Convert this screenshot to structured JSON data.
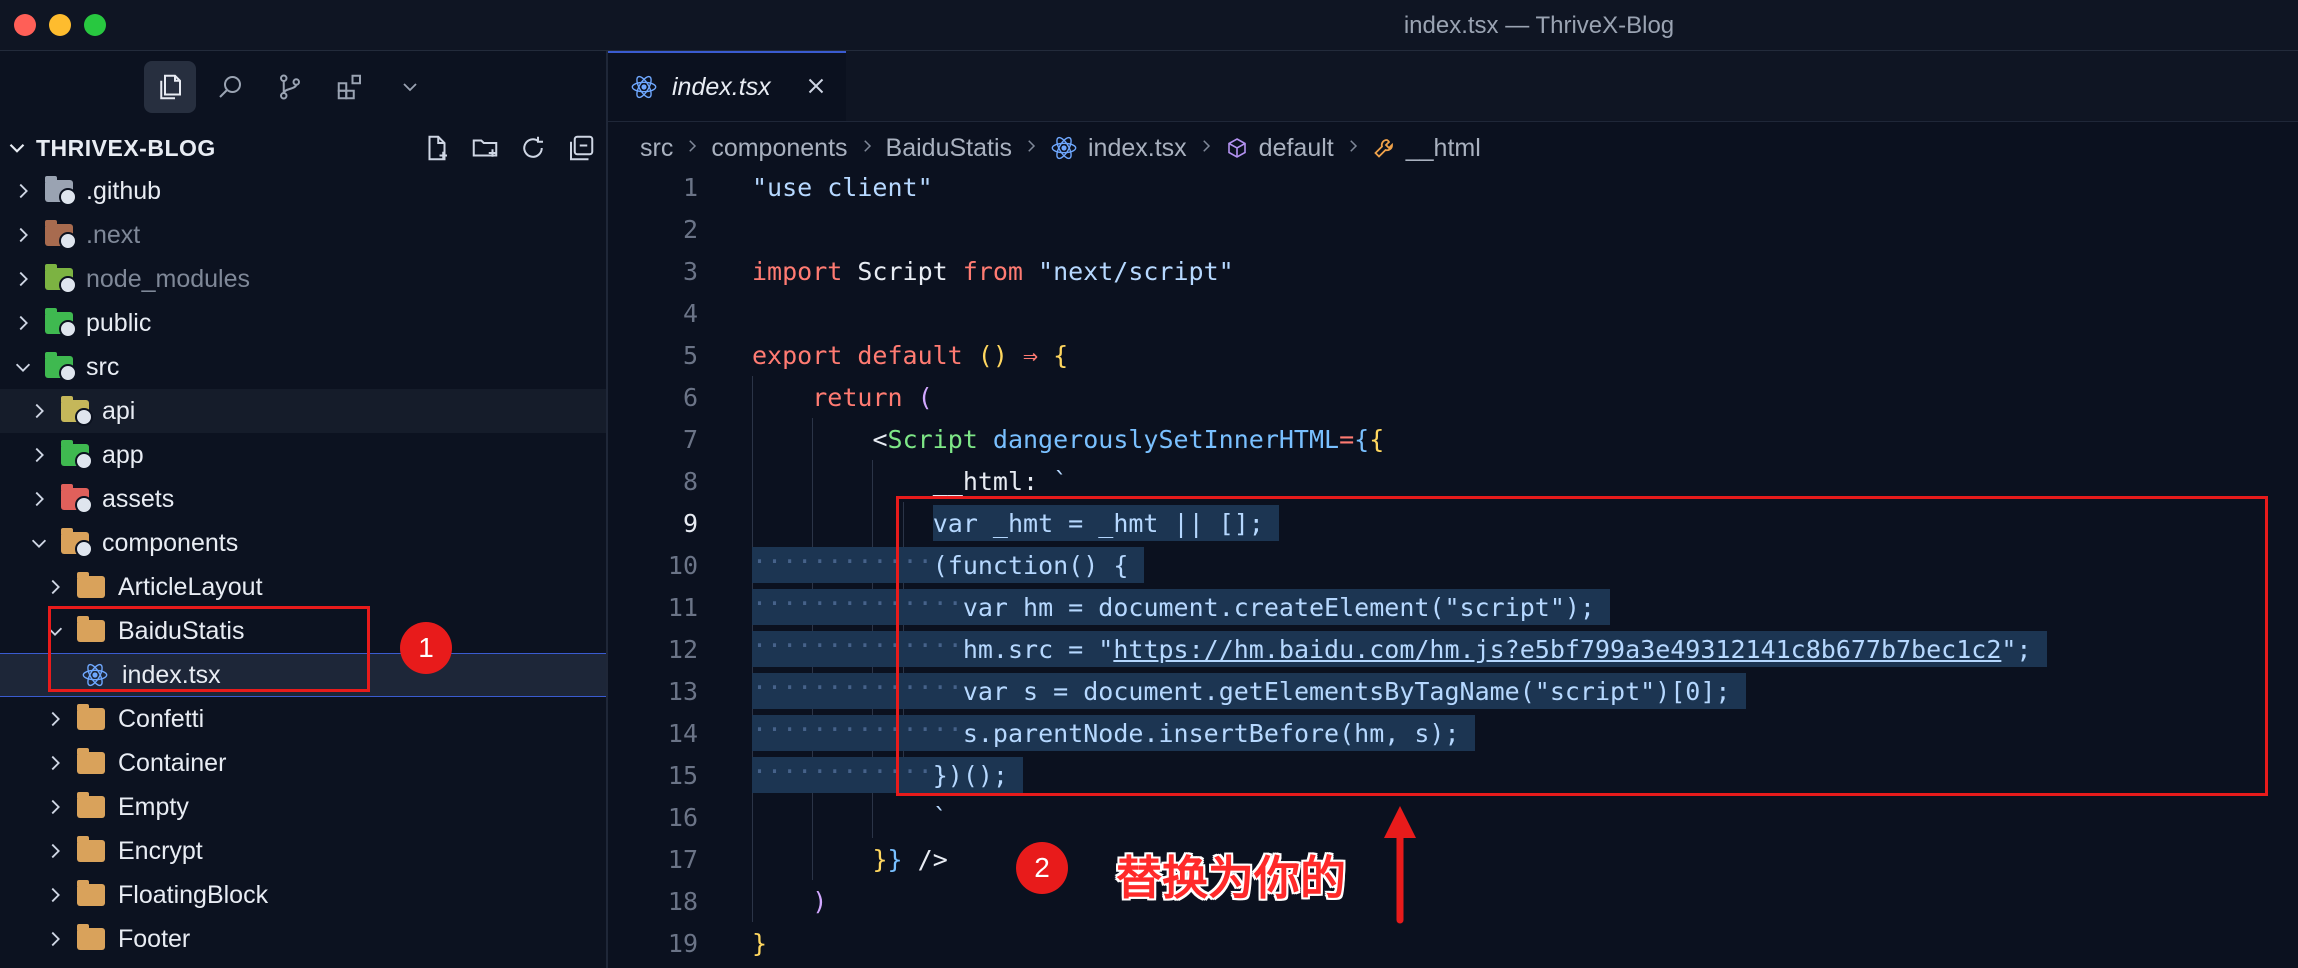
{
  "window": {
    "title": "index.tsx — ThriveX-Blog"
  },
  "sidebar": {
    "activity": [
      "files-icon",
      "search-icon",
      "source-control-icon",
      "extensions-icon",
      "chevron-down-icon"
    ],
    "explorer_title": "THRIVEX-BLOG",
    "tree": [
      {
        "label": ".github",
        "depth": 1,
        "state": "collapsed",
        "icon": "github-folder-icon",
        "color": "#9aa3b2"
      },
      {
        "label": ".next",
        "depth": 1,
        "state": "collapsed",
        "icon": "next-folder-icon",
        "color": "#a86b4f",
        "dim": true
      },
      {
        "label": "node_modules",
        "depth": 1,
        "state": "collapsed",
        "icon": "node-folder-icon",
        "color": "#7cb342",
        "dim": true
      },
      {
        "label": "public",
        "depth": 1,
        "state": "collapsed",
        "icon": "public-folder-icon",
        "color": "#3fb950"
      },
      {
        "label": "src",
        "depth": 1,
        "state": "expanded",
        "icon": "src-folder-icon",
        "color": "#3fb950"
      },
      {
        "label": "api",
        "depth": 2,
        "state": "collapsed",
        "icon": "api-folder-icon",
        "color": "#c5b75a",
        "hl": true
      },
      {
        "label": "app",
        "depth": 2,
        "state": "collapsed",
        "icon": "app-folder-icon",
        "color": "#3fb950"
      },
      {
        "label": "assets",
        "depth": 2,
        "state": "collapsed",
        "icon": "assets-folder-icon",
        "color": "#e0605b"
      },
      {
        "label": "components",
        "depth": 2,
        "state": "expanded",
        "icon": "components-folder-icon",
        "color": "#d9a25b"
      },
      {
        "label": "ArticleLayout",
        "depth": 3,
        "state": "collapsed",
        "icon": "folder-icon"
      },
      {
        "label": "BaiduStatis",
        "depth": 3,
        "state": "expanded",
        "icon": "folder-icon"
      },
      {
        "label": "index.tsx",
        "depth": 4,
        "state": "file",
        "icon": "react-icon",
        "sel": true
      },
      {
        "label": "Confetti",
        "depth": 3,
        "state": "collapsed",
        "icon": "folder-icon"
      },
      {
        "label": "Container",
        "depth": 3,
        "state": "collapsed",
        "icon": "folder-icon"
      },
      {
        "label": "Empty",
        "depth": 3,
        "state": "collapsed",
        "icon": "folder-icon"
      },
      {
        "label": "Encrypt",
        "depth": 3,
        "state": "collapsed",
        "icon": "folder-icon"
      },
      {
        "label": "FloatingBlock",
        "depth": 3,
        "state": "collapsed",
        "icon": "folder-icon"
      },
      {
        "label": "Footer",
        "depth": 3,
        "state": "collapsed",
        "icon": "folder-icon"
      }
    ]
  },
  "editor": {
    "tab_label": "index.tsx",
    "breadcrumb": [
      {
        "label": "src",
        "icon": ""
      },
      {
        "label": "components",
        "icon": ""
      },
      {
        "label": "BaiduStatis",
        "icon": ""
      },
      {
        "label": "index.tsx",
        "icon": "react-icon"
      },
      {
        "label": "default",
        "icon": "cube-icon"
      },
      {
        "label": "__html",
        "icon": "wrench-icon"
      }
    ],
    "current_line": 9,
    "lines": [
      {
        "n": "1",
        "indent": 0,
        "tokens": [
          [
            "str",
            "\"use client\""
          ]
        ]
      },
      {
        "n": "2",
        "indent": 0,
        "tokens": []
      },
      {
        "n": "3",
        "indent": 0,
        "tokens": [
          [
            "kw",
            "import"
          ],
          [
            "id",
            " Script "
          ],
          [
            "kw",
            "from"
          ],
          [
            "id",
            " "
          ],
          [
            "str",
            "\"next/script\""
          ]
        ]
      },
      {
        "n": "4",
        "indent": 0,
        "tokens": []
      },
      {
        "n": "5",
        "indent": 0,
        "tokens": [
          [
            "kw",
            "export"
          ],
          [
            "id",
            " "
          ],
          [
            "kw",
            "default"
          ],
          [
            "id",
            " "
          ],
          [
            "br1",
            "()"
          ],
          [
            "id",
            " "
          ],
          [
            "kw",
            "⇒"
          ],
          [
            "id",
            " "
          ],
          [
            "br1",
            "{"
          ]
        ]
      },
      {
        "n": "6",
        "indent": 1,
        "tokens": [
          [
            "kw",
            "return"
          ],
          [
            "id",
            " "
          ],
          [
            "br2",
            "("
          ]
        ]
      },
      {
        "n": "7",
        "indent": 2,
        "tokens": [
          [
            "punc",
            "<"
          ],
          [
            "tag",
            "Script"
          ],
          [
            "id",
            " "
          ],
          [
            "attr",
            "dangerouslySetInnerHTML"
          ],
          [
            "kw",
            "="
          ],
          [
            "br3",
            "{"
          ],
          [
            "br1",
            "{"
          ]
        ]
      },
      {
        "n": "8",
        "indent": 3,
        "tokens": [
          [
            "id",
            "__html: "
          ],
          [
            "str",
            "`"
          ]
        ]
      },
      {
        "n": "9",
        "indent": 0,
        "tokens": [
          [
            "str",
            "var _hmt = _hmt || [];"
          ]
        ]
      },
      {
        "n": "10",
        "indent": 0,
        "tokens": [
          [
            "str",
            "(function() {"
          ]
        ]
      },
      {
        "n": "11",
        "indent": 0,
        "tokens": [
          [
            "str",
            "var hm = document.createElement(\"script\");"
          ]
        ]
      },
      {
        "n": "12",
        "indent": 0,
        "tokens": [
          [
            "str",
            "hm.src = \""
          ],
          [
            "url",
            "https://hm.baidu.com/hm.js?e5bf799a3e49312141c8b677b7bec1c2"
          ],
          [
            "str",
            "\";"
          ]
        ]
      },
      {
        "n": "13",
        "indent": 0,
        "tokens": [
          [
            "str",
            "var s = document.getElementsByTagName(\"script\")[0];"
          ]
        ]
      },
      {
        "n": "14",
        "indent": 0,
        "tokens": [
          [
            "str",
            "s.parentNode.insertBefore(hm, s);"
          ]
        ]
      },
      {
        "n": "15",
        "indent": 0,
        "tokens": [
          [
            "str",
            "})();"
          ]
        ]
      },
      {
        "n": "16",
        "indent": 3,
        "tokens": [
          [
            "str",
            "`"
          ]
        ]
      },
      {
        "n": "17",
        "indent": 2,
        "tokens": [
          [
            "br1",
            "}"
          ],
          [
            "br3",
            "}"
          ],
          [
            "id",
            " "
          ],
          [
            "punc",
            "/>"
          ]
        ]
      },
      {
        "n": "18",
        "indent": 1,
        "tokens": [
          [
            "br2",
            ")"
          ]
        ]
      },
      {
        "n": "19",
        "indent": 0,
        "tokens": [
          [
            "br1",
            "}"
          ]
        ]
      }
    ]
  },
  "annotations": {
    "badge1": "1",
    "badge2": "2",
    "note": "替换为你的"
  },
  "colors": {
    "accent": "#3a5bd0",
    "annotation_red": "#e81b1b"
  }
}
